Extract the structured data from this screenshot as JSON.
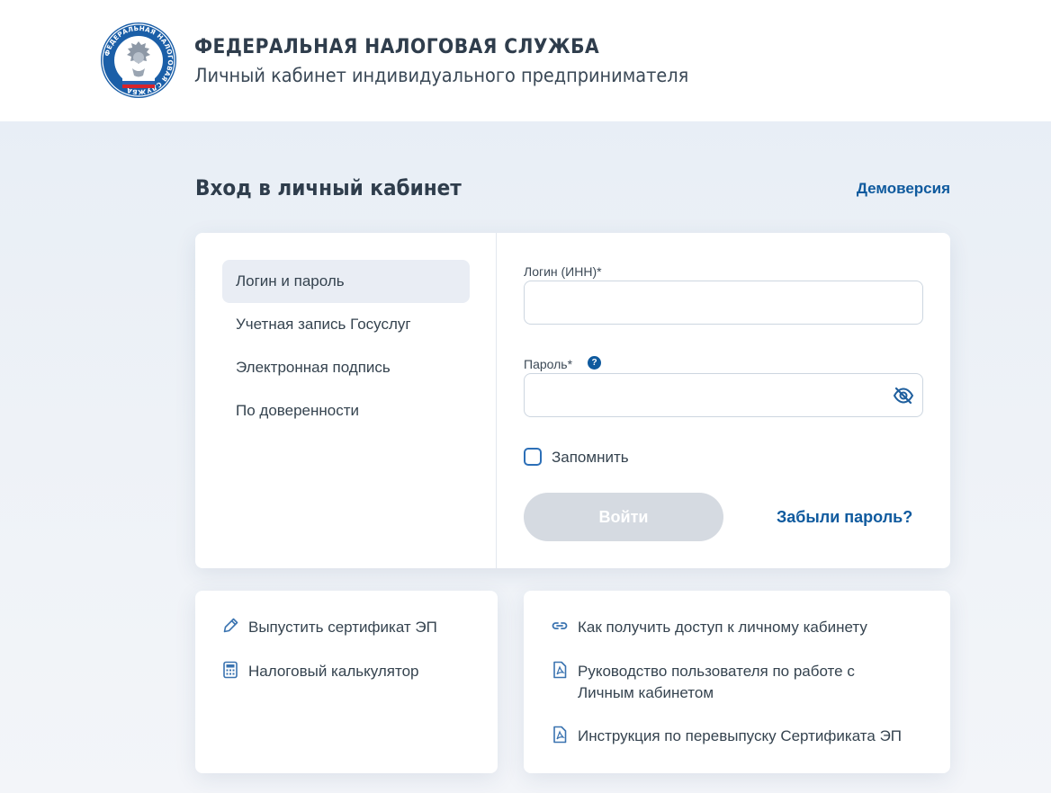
{
  "header": {
    "org_name": "ФЕДЕРАЛЬНАЯ НАЛОГОВАЯ СЛУЖБА",
    "subtitle": "Личный кабинет индивидуального предпринимателя",
    "logo_ring_text": "ФЕДЕРАЛЬНАЯ НАЛОГОВАЯ СЛУЖБА"
  },
  "page": {
    "title": "Вход в личный кабинет",
    "demo_link": "Демоверсия"
  },
  "login_methods": [
    {
      "label": "Логин и пароль",
      "active": true
    },
    {
      "label": "Учетная запись Госуслуг",
      "active": false
    },
    {
      "label": "Электронная подпись",
      "active": false
    },
    {
      "label": "По доверенности",
      "active": false
    }
  ],
  "form": {
    "login_label": "Логин (ИНН)*",
    "login_value": "",
    "password_label": "Пароль*",
    "password_value": "",
    "help_icon_text": "?",
    "remember_label": "Запомнить",
    "remember_checked": false,
    "submit_label": "Войти",
    "forgot_label": "Забыли пароль?"
  },
  "tools": [
    {
      "icon": "pen-icon",
      "label": "Выпустить сертификат ЭП"
    },
    {
      "icon": "calculator-icon",
      "label": "Налоговый калькулятор"
    }
  ],
  "help_links": [
    {
      "icon": "link-icon",
      "label": "Как получить доступ к личному кабинету"
    },
    {
      "icon": "pdf-icon",
      "label": "Руководство пользователя по работе с\nЛичным кабинетом"
    },
    {
      "icon": "pdf-icon",
      "label": "Инструкция по перевыпуску Сертификата ЭП"
    }
  ],
  "colors": {
    "accent": "#0f5a9e",
    "disabled_button": "#d5dae1",
    "active_item_bg": "#e9edf4"
  }
}
